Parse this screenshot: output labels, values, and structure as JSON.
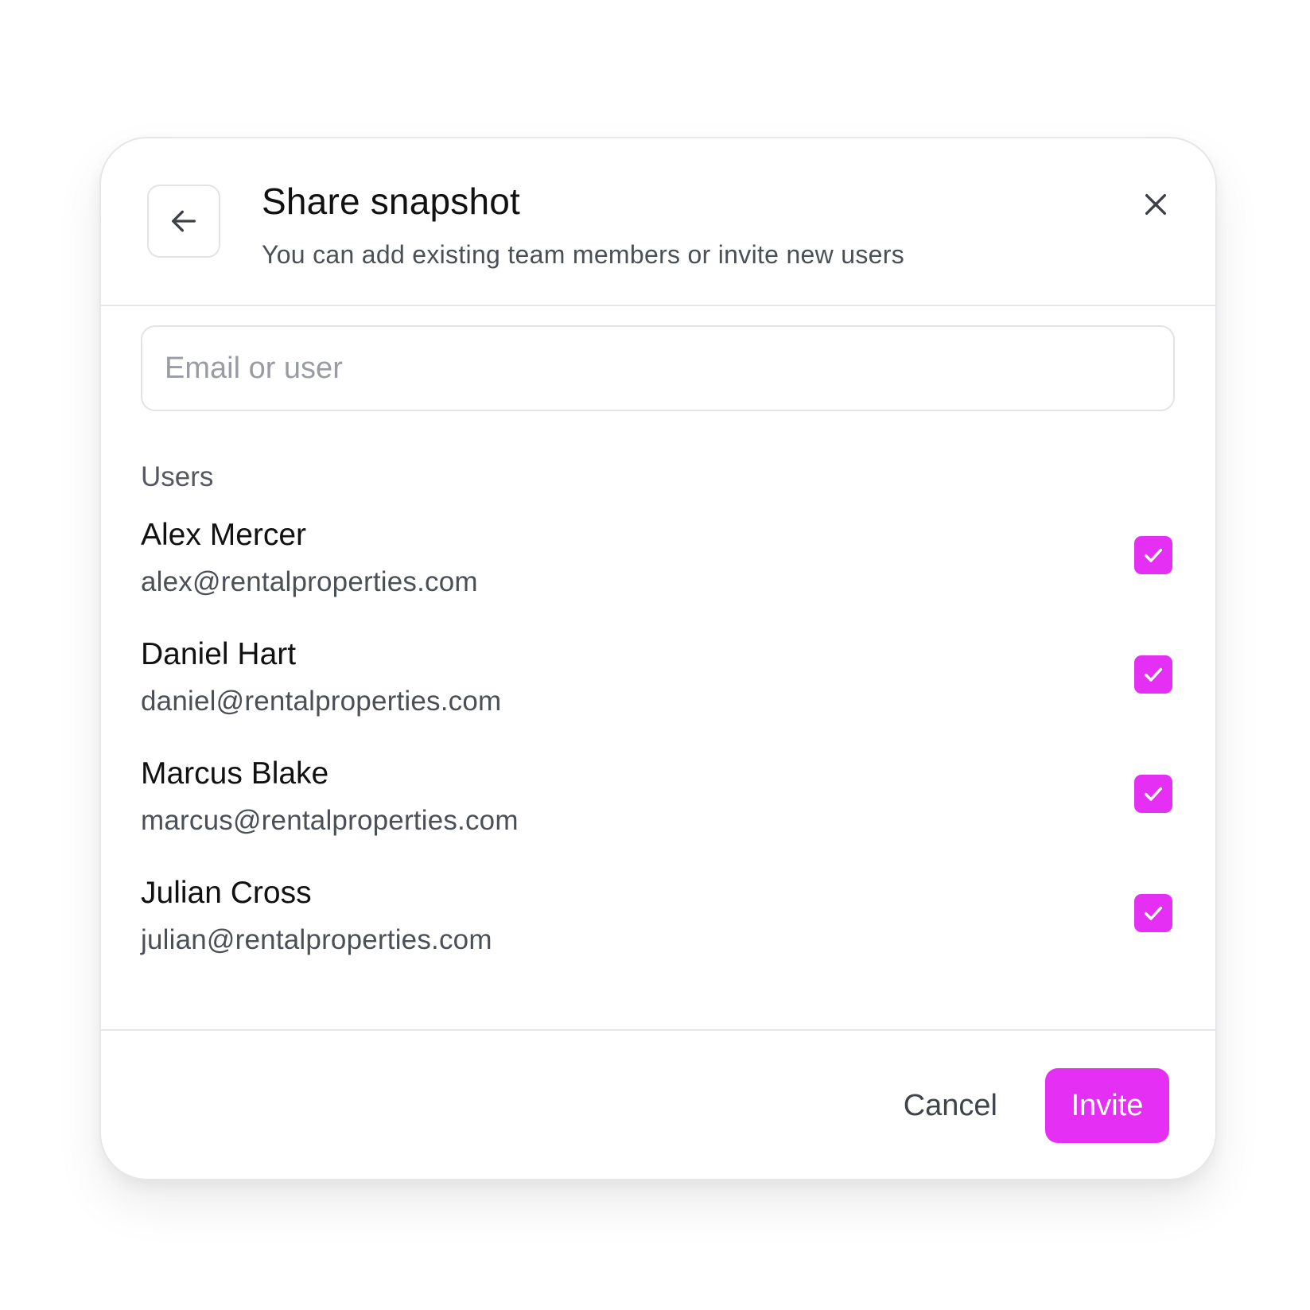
{
  "dialog": {
    "title": "Share snapshot",
    "subtitle": "You can add existing team members or invite new users",
    "back_icon": "arrow-left-icon",
    "close_icon": "close-icon"
  },
  "search": {
    "placeholder": "Email or user",
    "value": ""
  },
  "users_section": {
    "label": "Users",
    "items": [
      {
        "name": "Alex Mercer",
        "email": "alex@rentalproperties.com",
        "checked": true
      },
      {
        "name": "Daniel Hart",
        "email": "daniel@rentalproperties.com",
        "checked": true
      },
      {
        "name": "Marcus Blake",
        "email": "marcus@rentalproperties.com",
        "checked": true
      },
      {
        "name": "Julian Cross",
        "email": "julian@rentalproperties.com",
        "checked": true
      }
    ]
  },
  "footer": {
    "cancel_label": "Cancel",
    "invite_label": "Invite"
  },
  "colors": {
    "accent": "#e62ff5",
    "border": "#e6e7ea",
    "text_primary": "#111111",
    "text_secondary": "#4b4f56"
  }
}
